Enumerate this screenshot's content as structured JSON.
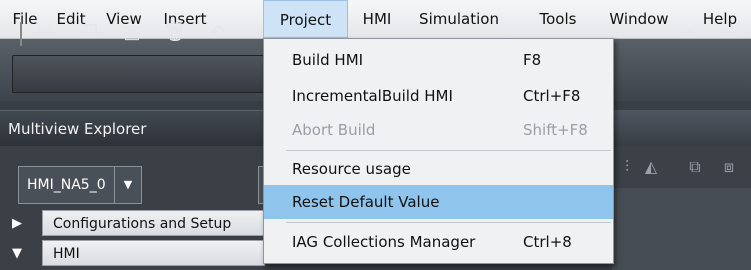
{
  "menubar": {
    "items": [
      "File",
      "Edit",
      "View",
      "Insert",
      "Project",
      "HMI",
      "Simulation",
      "Tools",
      "Window",
      "Help"
    ],
    "open_index": 4
  },
  "toolbar": {
    "icons": [
      "cut-icon",
      "copy-icon",
      "paste-icon",
      "delete-icon",
      "undo-icon",
      "find-icon",
      "window-icon"
    ]
  },
  "explorer": {
    "title": "Multiview Explorer",
    "device_select": "HMI_NA5_0",
    "tree": [
      {
        "label": "Configurations and Setup",
        "expanded": false
      },
      {
        "label": "HMI",
        "expanded": true
      }
    ]
  },
  "project_menu": {
    "items": [
      {
        "label": "Build HMI",
        "shortcut": "F8",
        "enabled": true,
        "highlighted": false
      },
      {
        "label": "IncrementalBuild HMI",
        "shortcut": "Ctrl+F8",
        "enabled": true,
        "highlighted": false
      },
      {
        "label": "Abort Build",
        "shortcut": "Shift+F8",
        "enabled": false,
        "highlighted": false
      },
      {
        "label": "Resource usage",
        "shortcut": "",
        "enabled": true,
        "highlighted": false
      },
      {
        "label": "Reset Default Value",
        "shortcut": "",
        "enabled": true,
        "highlighted": true
      },
      {
        "label": "IAG Collections Manager",
        "shortcut": "Ctrl+8",
        "enabled": true,
        "highlighted": false
      }
    ]
  },
  "colors": {
    "menu_highlight": "#8fc4ec",
    "open_menu_bg": "#cfe3f6",
    "disabled_text": "#9a9ea3",
    "dark_chrome": "#3a3f45"
  }
}
